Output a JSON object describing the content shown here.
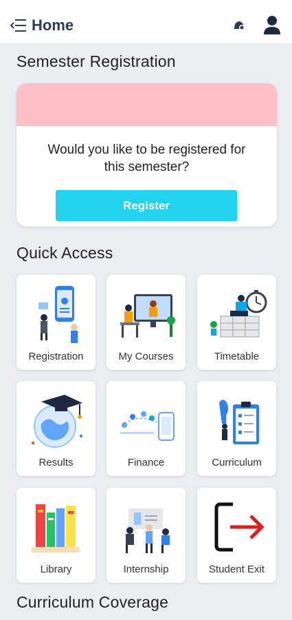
{
  "appbar": {
    "title": "Home",
    "menu_icon": "menu-icon",
    "notification_icon": "notification-icon",
    "user_icon": "user-icon"
  },
  "semester_registration": {
    "heading": "Semester Registration",
    "question": "Would you like to be registered for this semester?",
    "button_label": "Register",
    "banner_color": "#ffc0c8",
    "button_color": "#22d3ee"
  },
  "quick_access": {
    "heading": "Quick Access",
    "tiles": [
      {
        "label": "Registration",
        "icon": "registration-icon"
      },
      {
        "label": "My Courses",
        "icon": "courses-icon"
      },
      {
        "label": "Timetable",
        "icon": "timetable-icon"
      },
      {
        "label": "Results",
        "icon": "results-icon"
      },
      {
        "label": "Finance",
        "icon": "finance-icon"
      },
      {
        "label": "Curriculum",
        "icon": "curriculum-icon"
      },
      {
        "label": "Library",
        "icon": "library-icon"
      },
      {
        "label": "Internship",
        "icon": "internship-icon"
      },
      {
        "label": "Student Exit",
        "icon": "exit-icon"
      }
    ]
  },
  "curriculum_coverage": {
    "heading": "Curriculum Coverage"
  }
}
